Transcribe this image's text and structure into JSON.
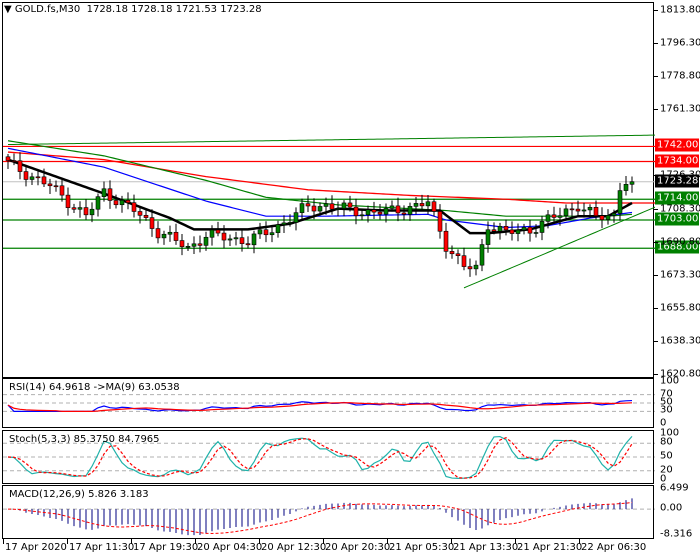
{
  "header": {
    "symbol": "GOLD.fs,M30",
    "open": "1728.18",
    "high": "1728.18",
    "low": "1721.53",
    "close": "1723.28",
    "icon": "triangle-down-icon"
  },
  "chart_data": {
    "type": "candlestick",
    "price_axis": {
      "min": 1620.8,
      "max": 1813.8,
      "ticks": [
        "1813.80",
        "1796.30",
        "1778.80",
        "1761.30",
        "1726.30",
        "1708.30",
        "1690.80",
        "1673.30",
        "1655.80",
        "1638.30",
        "1620.80"
      ]
    },
    "levels": [
      {
        "price": 1742.0,
        "label": "1742.00",
        "color": "#ff0000"
      },
      {
        "price": 1734.0,
        "label": "1734.00",
        "color": "#ff0000"
      },
      {
        "price": 1714.0,
        "label": "1714.00",
        "color": "#008000"
      },
      {
        "price": 1703.0,
        "label": "1703.00",
        "color": "#008000"
      },
      {
        "price": 1688.0,
        "label": "1688.00",
        "color": "#008000"
      }
    ],
    "current_price": {
      "price": 1723.28,
      "label": "1723.28"
    },
    "bar_count": 105,
    "close_keypoints": [
      [
        0,
        1733
      ],
      [
        7,
        1721
      ],
      [
        13,
        1705
      ],
      [
        16,
        1718
      ],
      [
        21,
        1708
      ],
      [
        25,
        1697
      ],
      [
        30,
        1688
      ],
      [
        33,
        1695
      ],
      [
        40,
        1692
      ],
      [
        43,
        1696
      ],
      [
        50,
        1710
      ],
      [
        53,
        1711
      ],
      [
        57,
        1708
      ],
      [
        63,
        1707
      ],
      [
        70,
        1712
      ],
      [
        73,
        1690
      ],
      [
        76,
        1678
      ],
      [
        78,
        1677
      ],
      [
        80,
        1701
      ],
      [
        83,
        1696
      ],
      [
        87,
        1698
      ],
      [
        92,
        1706
      ],
      [
        95,
        1711
      ],
      [
        98,
        1704
      ],
      [
        101,
        1706
      ],
      [
        102,
        1721
      ],
      [
        104,
        1726
      ]
    ],
    "ma_black": [
      [
        0,
        1735
      ],
      [
        16,
        1717
      ],
      [
        27,
        1704
      ],
      [
        31,
        1698
      ],
      [
        40,
        1698
      ],
      [
        47,
        1701
      ],
      [
        55,
        1709
      ],
      [
        63,
        1708
      ],
      [
        72,
        1708
      ],
      [
        77,
        1696
      ],
      [
        80,
        1696
      ],
      [
        87,
        1698
      ],
      [
        95,
        1705
      ],
      [
        100,
        1705
      ],
      [
        104,
        1712
      ]
    ],
    "ma_blue": [
      [
        0,
        1741
      ],
      [
        16,
        1731
      ],
      [
        33,
        1713
      ],
      [
        43,
        1705
      ],
      [
        53,
        1705
      ],
      [
        70,
        1706
      ],
      [
        73,
        1703
      ],
      [
        83,
        1699
      ],
      [
        90,
        1700
      ],
      [
        97,
        1704
      ],
      [
        104,
        1707
      ]
    ],
    "ma_green": [
      [
        0,
        1745
      ],
      [
        16,
        1737
      ],
      [
        33,
        1724
      ],
      [
        43,
        1715
      ],
      [
        55,
        1711
      ],
      [
        73,
        1708
      ],
      [
        83,
        1705
      ],
      [
        100,
        1705
      ],
      [
        104,
        1706
      ]
    ],
    "ma_red": [
      [
        0,
        1739
      ],
      [
        16,
        1735
      ],
      [
        33,
        1726
      ],
      [
        50,
        1719
      ],
      [
        67,
        1716
      ],
      [
        83,
        1714
      ],
      [
        93,
        1712
      ],
      [
        108,
        1712
      ]
    ],
    "trend_top": [
      [
        0,
        1743
      ],
      [
        108,
        1748
      ]
    ],
    "trend_support": [
      [
        76,
        1667
      ],
      [
        108,
        1710
      ]
    ],
    "time_labels": [
      "17 Apr 2020",
      "17 Apr 11:30",
      "17 Apr 19:30",
      "20 Apr 04:30",
      "20 Apr 12:30",
      "20 Apr 20:30",
      "21 Apr 05:30",
      "21 Apr 13:30",
      "21 Apr 21:30",
      "22 Apr 06:30"
    ]
  },
  "rsi": {
    "label": "RSI(14) 64.9618  ->MA(9) 63.0538",
    "ticks": [
      "100",
      "70",
      "50",
      "30",
      "0"
    ]
  },
  "stoch": {
    "label": "Stoch(5,3,3) 85.3750 84.7965",
    "ticks": [
      "100",
      "80",
      "50",
      "20",
      "0"
    ]
  },
  "macd": {
    "label": "MACD(12,26,9) 5.826 3.183",
    "ticks": [
      "6.499",
      "0.00",
      "-8.316"
    ]
  }
}
